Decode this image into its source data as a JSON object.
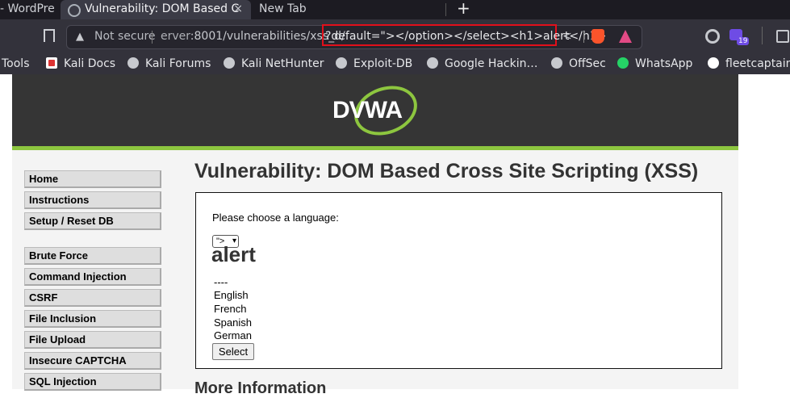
{
  "browser": {
    "tabs": [
      {
        "label": "- WordPre"
      },
      {
        "label": "Vulnerability: DOM Based C",
        "active": true
      },
      {
        "label": "New Tab"
      }
    ],
    "new_tab_glyph": "+",
    "close_glyph": "×",
    "omnibox": {
      "security_label": "Not secure",
      "url_host": "erver",
      "url_path": ":8001/vulnerabilities/xss_d/",
      "url_query": "?default=\"></option></select><h1>alert</h1>",
      "highlight_color": "#e1101b"
    },
    "extension_badge": "19",
    "bookmarks": [
      {
        "label": "Tools",
        "icon": "none"
      },
      {
        "label": "Kali Docs",
        "icon": "kali-icon"
      },
      {
        "label": "Kali Forums",
        "icon": "globe-icon"
      },
      {
        "label": "Kali NetHunter",
        "icon": "globe-icon"
      },
      {
        "label": "Exploit-DB",
        "icon": "globe-icon"
      },
      {
        "label": "Google Hackin…",
        "icon": "globe-icon"
      },
      {
        "label": "OffSec",
        "icon": "globe-icon"
      },
      {
        "label": "WhatsApp",
        "icon": "whatsapp-icon"
      },
      {
        "label": "fleetcaptain",
        "icon": "github-icon"
      }
    ]
  },
  "dvwa": {
    "logo_text": "DVWA",
    "accent_color": "#8dc63f",
    "menu": [
      {
        "label": "Home"
      },
      {
        "label": "Instructions"
      },
      {
        "label": "Setup / Reset DB"
      },
      {
        "label": "Brute Force"
      },
      {
        "label": "Command Injection"
      },
      {
        "label": "CSRF"
      },
      {
        "label": "File Inclusion"
      },
      {
        "label": "File Upload"
      },
      {
        "label": "Insecure CAPTCHA"
      },
      {
        "label": "SQL Injection"
      }
    ],
    "title": "Vulnerability: DOM Based Cross Site Scripting (XSS)",
    "choose_label": "Please choose a language:",
    "select_value": "\">",
    "injected_heading": "alert",
    "options": [
      "----",
      "English",
      "French",
      "Spanish",
      "German"
    ],
    "submit_label": "Select",
    "more_info": "More Information"
  }
}
